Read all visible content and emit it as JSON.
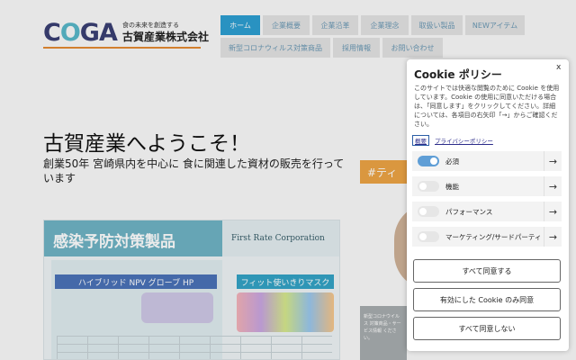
{
  "logo": {
    "word": [
      "C",
      "O",
      "GA"
    ],
    "tagline": "食の未来を創造する",
    "company": "古賀産業株式会社"
  },
  "nav": {
    "row1": [
      "ホーム",
      "企業概要",
      "企業沿革",
      "企業理念",
      "取扱い製品",
      "NEWアイテム"
    ],
    "row2": [
      "新型コロナウィルス対策商品",
      "採用情報",
      "お問い合わせ"
    ]
  },
  "hero": {
    "title": "古賀産業へようこそ！",
    "subtitle": "創業50年 宮崎県内を中心に 食に関連した資材の販売を行っています"
  },
  "product_panel": {
    "title": "感染予防対策製品",
    "corp": "First Rate Corporation",
    "glove_name": "ハイブリッド NPV グローブ HP",
    "mask_name": "フィット使いきりマスク"
  },
  "side": {
    "topic_label": "#ティ",
    "news_excerpt": "新型コロナウイルス 対策商品・サービス情報 ください。"
  },
  "cookie": {
    "title": "Cookie ポリシー",
    "close": "x",
    "description_lines": [
      "このサイトでは快適な閲覧のために Cookie を使用",
      "しています。Cookie の使用に同意いただける場合",
      "は、「同意します」をクリックしてください。詳細",
      "については、各項目の右矢印「→」からご確認くだ",
      "さい。"
    ],
    "outline_link": "概要",
    "policy_link": "プライバシーポリシー",
    "categories": [
      {
        "label": "必須",
        "enabled": true
      },
      {
        "label": "機能",
        "enabled": false
      },
      {
        "label": "パフォーマンス",
        "enabled": false
      },
      {
        "label": "マーケティング/サードパーティ",
        "enabled": false
      }
    ],
    "arrow": "→",
    "buttons": {
      "accept_all": "すべて同意する",
      "accept_enabled": "有効にした Cookie のみ同意",
      "reject_all": "すべて同意しない"
    }
  },
  "colors": {
    "nav_active": "#2d9fd2",
    "logo_navy": "#3a3f73",
    "logo_teal": "#58b8c9",
    "toggle_on": "#5f9ed6",
    "accent_orange": "#eda445"
  }
}
